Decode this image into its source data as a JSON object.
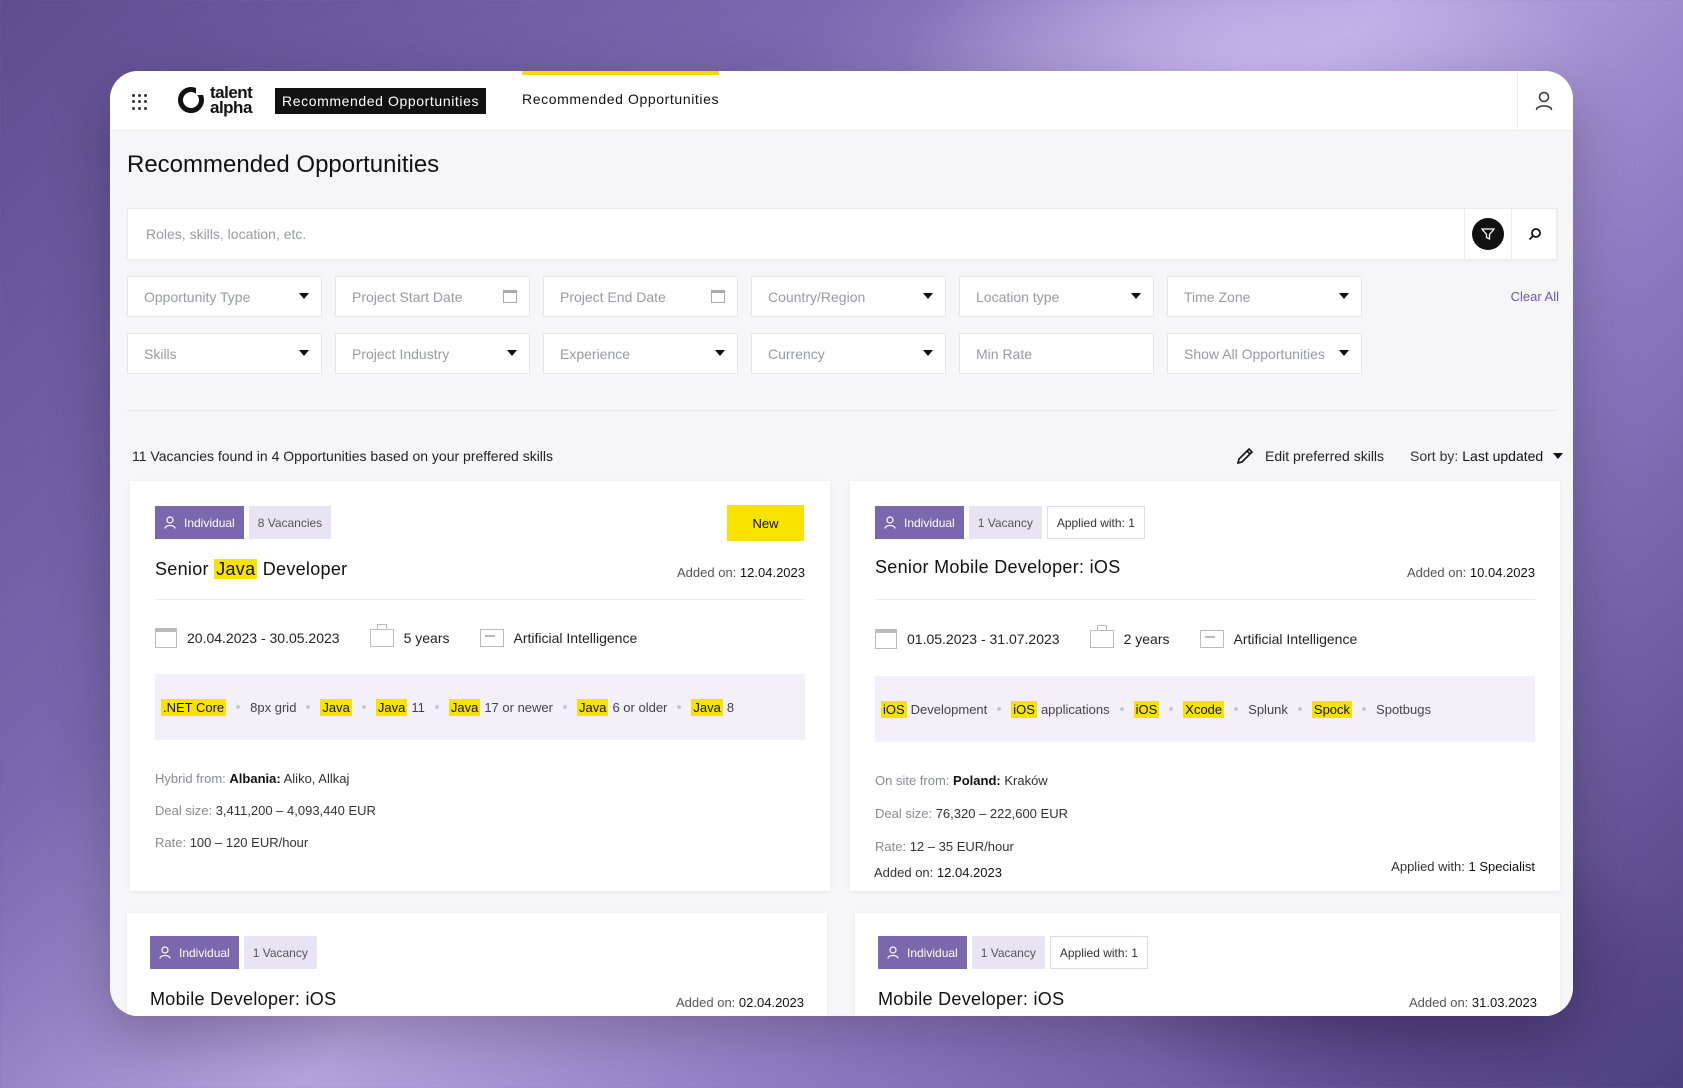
{
  "topbar": {
    "logo_line1": "talent",
    "logo_line2": "alpha",
    "app_badge": "Recommended Opportunities",
    "nav_tab": "Recommended Opportunities"
  },
  "page": {
    "title": "Recommended Opportunities"
  },
  "search": {
    "placeholder": "Roles, skills, location, etc."
  },
  "filters_row1": [
    "Opportunity Type",
    "Project Start Date",
    "Project End Date",
    "Country/Region",
    "Location type",
    "Time Zone"
  ],
  "filters_row2": [
    "Skills",
    "Project Industry",
    "Experience",
    "Currency",
    "Min Rate",
    "Show All Opportunities"
  ],
  "clear_all": "Clear All",
  "results": {
    "summary": "11 Vacancies found in 4 Opportunities based on your preffered skills",
    "edit_skills": "Edit preferred skills",
    "sort_label": "Sort by:",
    "sort_value": "Last updated"
  },
  "cards": [
    {
      "type_tag": "Individual",
      "vacancies": "8 Vacancies",
      "new_badge": "New",
      "title_pre": "Senior",
      "title_hl": "Java",
      "title_post": "Developer",
      "added_label": "Added on:",
      "added_date": "12.04.2023",
      "dates": "20.04.2023 - 30.05.2023",
      "experience": "5 years",
      "industry": "Artificial Intelligence",
      "skills": [
        {
          "hl": ".NET Core",
          "rest": ""
        },
        {
          "hl": "",
          "rest": "8px grid"
        },
        {
          "hl": "Java",
          "rest": ""
        },
        {
          "hl": "Java",
          "rest": "11"
        },
        {
          "hl": "Java",
          "rest": "17 or newer"
        },
        {
          "hl": "Java",
          "rest": "6 or older"
        },
        {
          "hl": "Java",
          "rest": "8"
        }
      ],
      "location_label": "Hybrid from:",
      "location_country": "Albania:",
      "location_city": "Aliko, Allkaj",
      "deal_label": "Deal size:",
      "deal_value": "3,411,200 – 4,093,440 EUR",
      "rate_label": "Rate:",
      "rate_value": "100 – 120 EUR/hour"
    },
    {
      "type_tag": "Individual",
      "vacancies": "1 Vacancy",
      "applied": "Applied with: 1",
      "title": "Senior Mobile Developer: iOS",
      "added_label": "Added on:",
      "added_date": "10.04.2023",
      "dates": "01.05.2023 - 31.07.2023",
      "experience": "2 years",
      "industry": "Artificial Intelligence",
      "skills": [
        {
          "hl": "iOS",
          "rest": "Development"
        },
        {
          "hl": "iOS",
          "rest": "applications"
        },
        {
          "hl": "iOS",
          "rest": ""
        },
        {
          "hl": "Xcode",
          "rest": ""
        },
        {
          "hl": "",
          "rest": "Splunk"
        },
        {
          "hl": "Spock",
          "rest": ""
        },
        {
          "hl": "",
          "rest": "Spotbugs"
        }
      ],
      "location_label": "On site from:",
      "location_country": "Poland:",
      "location_city": "Kraków",
      "deal_label": "Deal size:",
      "deal_value": "76,320 – 222,600 EUR",
      "rate_label": "Rate:",
      "rate_value": "12 – 35 EUR/hour",
      "added2_label": "Added on:",
      "added2_date": "12.04.2023",
      "applied_with_label": "Applied with:",
      "applied_with_value": "1 Specialist"
    },
    {
      "type_tag": "Individual",
      "vacancies": "1 Vacancy",
      "title": "Mobile Developer: iOS",
      "added_label": "Added on:",
      "added_date": "02.04.2023"
    },
    {
      "type_tag": "Individual",
      "vacancies": "1 Vacancy",
      "applied": "Applied with: 1",
      "title": "Mobile Developer: iOS",
      "added_label": "Added on:",
      "added_date": "31.03.2023"
    }
  ]
}
